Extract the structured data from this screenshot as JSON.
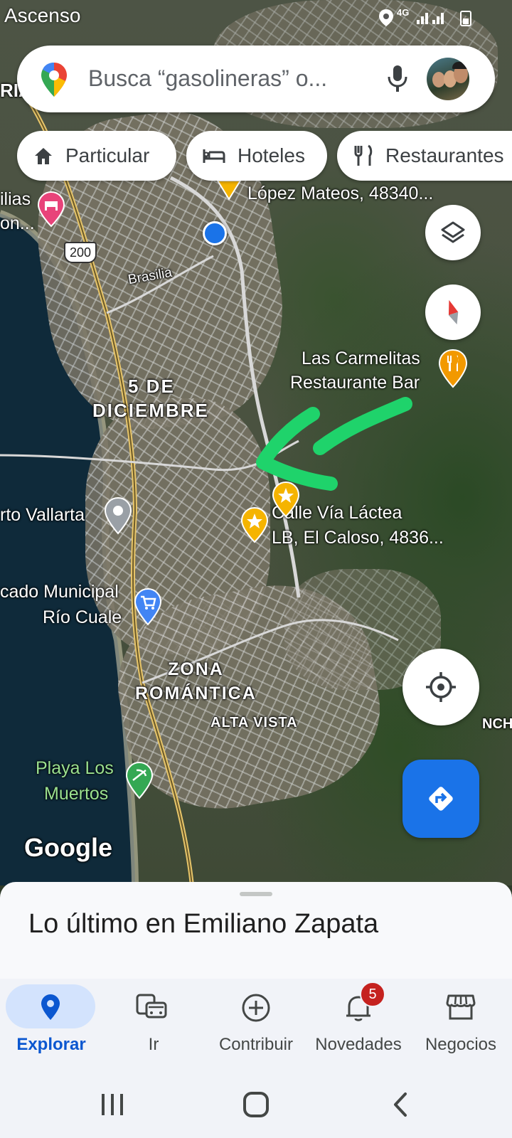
{
  "status_bar": {
    "left_text": "Ascenso"
  },
  "search": {
    "placeholder": "Busca “gasolineras” o..."
  },
  "chips": [
    {
      "label": "Particular",
      "icon": "home-icon"
    },
    {
      "label": "Hoteles",
      "icon": "bed-icon"
    },
    {
      "label": "Restaurantes",
      "icon": "fork-knife-icon"
    }
  ],
  "map": {
    "labels": {
      "lopez": "López Mateos, 48340...",
      "ilias": "ilias",
      "on": "on...",
      "route": "200",
      "brasilia": "Brasilia",
      "carmelitas_1": "Las Carmelitas",
      "carmelitas_2": "Restaurante Bar",
      "dic_1": "5 DE",
      "dic_2": "DICIEMBRE",
      "vallarta": "rto Vallarta",
      "lactea_1": "Calle Vía Láctea",
      "lactea_2": "LB, El Caloso, 4836...",
      "mercado_1": "cado Municipal",
      "mercado_2": "Río Cuale",
      "zona_1": "ZONA",
      "zona_2": "ROMÁNTICA",
      "alta_vista": "ALTA VISTA",
      "nch": "NCH",
      "playa_1": "Playa Los",
      "playa_2": "Muertos",
      "google": "Google",
      "ria": "RIA"
    }
  },
  "sheet": {
    "title": "Lo último en Emiliano Zapata"
  },
  "nav": [
    {
      "label": "Explorar",
      "active": true
    },
    {
      "label": "Ir"
    },
    {
      "label": "Contribuir"
    },
    {
      "label": "Novedades",
      "badge": "5"
    },
    {
      "label": "Negocios"
    }
  ],
  "colors": {
    "accent": "#0b57d0",
    "directions": "#1a73e8",
    "annotation_arrow": "#1fd36b",
    "marker_gold": "#f5b400"
  }
}
